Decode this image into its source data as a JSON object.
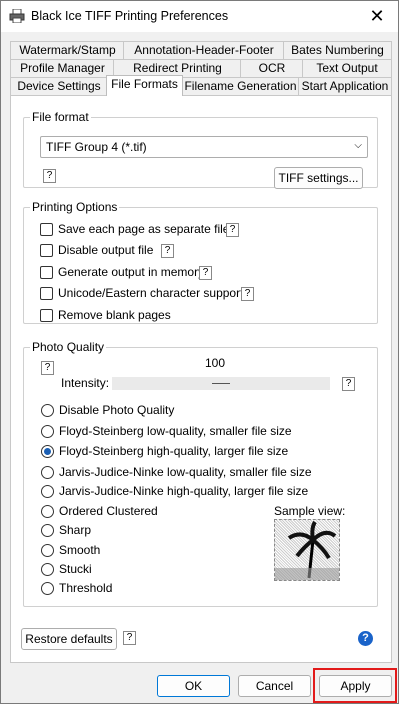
{
  "window": {
    "title": "Black Ice TIFF Printing Preferences",
    "close_glyph": "✕"
  },
  "tabs": {
    "row1": [
      "Watermark/Stamp",
      "Annotation-Header-Footer",
      "Bates Numbering"
    ],
    "row2": [
      "Profile Manager",
      "Redirect Printing",
      "OCR",
      "Text Output"
    ],
    "row3": [
      "Device Settings",
      "File Formats",
      "Filename Generation",
      "Start Application"
    ],
    "active": "File Formats"
  },
  "file_format": {
    "legend": "File format",
    "selected": "TIFF Group 4 (*.tif)",
    "settings_button": "TIFF settings..."
  },
  "printing_options": {
    "legend": "Printing Options",
    "options": [
      "Save each page as separate file",
      "Disable output file",
      "Generate output in memory",
      "Unicode/Eastern character support",
      "Remove blank pages"
    ]
  },
  "photo_quality": {
    "legend": "Photo Quality",
    "intensity_value": "100",
    "intensity_label": "Intensity:",
    "options": [
      "Disable Photo Quality",
      "Floyd-Steinberg low-quality, smaller file size",
      "Floyd-Steinberg high-quality, larger file size",
      "Jarvis-Judice-Ninke low-quality, smaller file size",
      "Jarvis-Judice-Ninke high-quality, larger file size",
      "Ordered Clustered",
      "Sharp",
      "Smooth",
      "Stucki",
      "Threshold"
    ],
    "selected_index": 2,
    "sample_label": "Sample view:"
  },
  "help_glyph": "?",
  "restore_defaults": "Restore defaults",
  "footer": {
    "ok": "OK",
    "cancel": "Cancel",
    "apply": "Apply"
  },
  "colors": {
    "highlight": "#e21a1a",
    "radio_selected": "#1a5fb4",
    "help_blue": "#1a63c9"
  }
}
